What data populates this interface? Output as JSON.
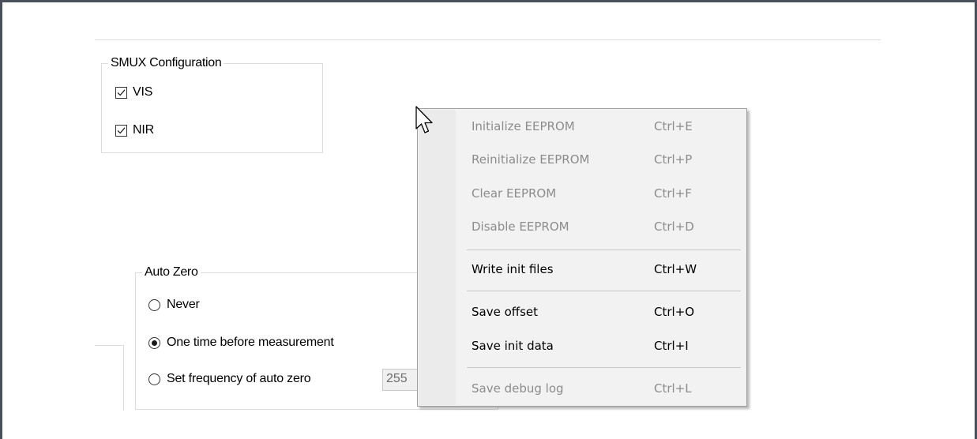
{
  "smux": {
    "title": "SMUX Configuration",
    "options": [
      {
        "label": "VIS",
        "checked": true
      },
      {
        "label": "NIR",
        "checked": true
      }
    ]
  },
  "autozero": {
    "title": "Auto Zero",
    "options": [
      {
        "label": "Never",
        "selected": false
      },
      {
        "label": "One time before measurement",
        "selected": true
      },
      {
        "label": "Set frequency of auto zero",
        "selected": false
      }
    ],
    "frequency_value": "255"
  },
  "context_menu": {
    "items": [
      {
        "label": "Initialize EEPROM",
        "shortcut": "Ctrl+E",
        "enabled": false
      },
      {
        "label": "Reinitialize EEPROM",
        "shortcut": "Ctrl+P",
        "enabled": false
      },
      {
        "label": "Clear EEPROM",
        "shortcut": "Ctrl+F",
        "enabled": false
      },
      {
        "label": "Disable EEPROM",
        "shortcut": "Ctrl+D",
        "enabled": false
      },
      {
        "label": "Write init files",
        "shortcut": "Ctrl+W",
        "enabled": true
      },
      {
        "label": "Save offset",
        "shortcut": "Ctrl+O",
        "enabled": true
      },
      {
        "label": "Save init data",
        "shortcut": "Ctrl+I",
        "enabled": true
      },
      {
        "label": "Save debug log",
        "shortcut": "Ctrl+L",
        "enabled": false
      }
    ]
  },
  "colors": {
    "frame_border": "#4a5059",
    "menu_background": "#f2f2f2",
    "disabled_text": "#8c8c8c"
  },
  "icons": {
    "cursor": "arrow-pointer-icon"
  }
}
